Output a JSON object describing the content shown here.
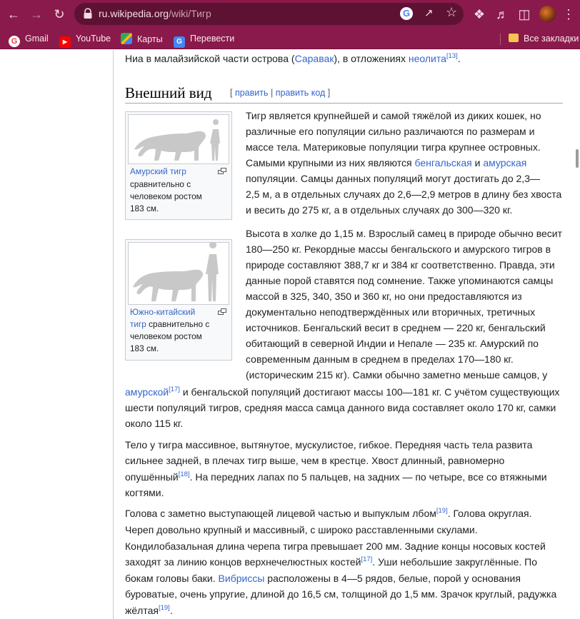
{
  "browser": {
    "url_host": "ru.wikipedia.org",
    "url_path": "/wiki/Тигр",
    "bookmarks": [
      {
        "label": "Gmail",
        "icon": "google-icon"
      },
      {
        "label": "YouTube",
        "icon": "youtube-icon"
      },
      {
        "label": "Карты",
        "icon": "maps-icon"
      },
      {
        "label": "Перевести",
        "icon": "translate-icon"
      }
    ],
    "all_bookmarks_label": "Все закладки"
  },
  "article": {
    "intro_line_a": "Ниа в малайзийской части острова (",
    "intro_link": "Саравак",
    "intro_line_b": "), в отложениях ",
    "intro_link2": "неолита",
    "intro_ref": "[13]",
    "intro_end": ".",
    "section_title": "Внешний вид",
    "edit_open": "[ ",
    "edit_label": "править",
    "edit_sep": " | ",
    "edit_code_label": "править код",
    "edit_close": " ]",
    "p1": {
      "l1": "Тигр является крупнейшей и самой тяжёлой из диких кошек, но",
      "l2": "различные его популяции сильно различаются по размерам и",
      "l3": "массе тела. Материковые популяции тигра крупнее островных.",
      "l4a": "Самыми крупными из них являются ",
      "l4_link1": "бенгальская",
      "l4b": " и ",
      "l4_link2": "амурская",
      "l5": "популяции. Самцы данных популяций могут достигать до 2,3—",
      "l6": "2,5 м, а в отдельных случаях до 2,6—2,9 метров в длину без хвоста",
      "l7": "и весить до 275 кг, а в отдельных случаях до 300—320 кг."
    },
    "p2": {
      "l1": "Высота в холке до 1,15 м. Взрослый самец в природе обычно весит",
      "l2": "180—250 кг. Рекордные массы бенгальского и амурского тигров в",
      "l3": "природе составляют 388,7 кг и 384 кг соответственно. Правда, эти",
      "l4": "данные порой ставятся под сомнение. Также упоминаются самцы",
      "l5": "массой в 325, 340, 350 и 360 кг, но они предоставляются из",
      "l6": "документально неподтверждённых или вторичных, третичных",
      "l7": "источников. Бенгальский весит в среднем — 220 кг, бенгальский",
      "l8": "обитающий в северной Индии и Непале — 235 кг. Амурский по",
      "l9": "современным данным в среднем в пределах 170—180 кг.",
      "l10": "(историческим 215 кг). Самки обычно заметно меньше самцов, у",
      "l11_link": "амурской",
      "l11_ref": "[17]",
      "l11b": " и бенгальской популяций достигают массы 100—181 кг. С учётом существующих",
      "l12": "шести популяций тигров, средняя масса самца данного вида составляет около 170 кг, самки",
      "l13": "около 115 кг."
    },
    "p3": {
      "l1": "Тело у тигра массивное, вытянутое, мускулистое, гибкое. Передняя часть тела развита",
      "l2": "сильнее задней, в плечах тигр выше, чем в крестце. Хвост длинный, равномерно",
      "l3a": "опушённый",
      "l3_ref": "[18]",
      "l3b": ". На передних лапах по 5 пальцев, на задних — по четыре, все со втяжными",
      "l4": "когтями."
    },
    "p4": {
      "l1a": "Голова с заметно выступающей лицевой частью и выпуклым лбом",
      "l1_ref": "[19]",
      "l1b": ". Голова округлая.",
      "l2": "Череп довольно крупный и массивный, с широко расставленными скулами.",
      "l3": "Кондилобазальная длина черепа тигра превышает 200 мм. Задние концы носовых костей",
      "l4a": "заходят за линию концов верхнечелюстных костей",
      "l4_ref": "[17]",
      "l4b": ". Уши небольшие закруглённые. По",
      "l5a": "бокам головы баки. ",
      "l5_link": "Вибриссы",
      "l5b": " расположены в 4—5 рядов, белые, порой у основания",
      "l6": "буроватые, очень упругие, длиной до 16,5 см, толщиной до 1,5 мм. Зрачок круглый, радужка",
      "l7a": "жёлтая",
      "l7_ref": "[19]",
      "l7b": "."
    },
    "figure1": {
      "caption_link": "Амурский тигр",
      "caption_l2": "сравнительно с",
      "caption_l3": "человеком ростом",
      "caption_l4": "183 см."
    },
    "figure2": {
      "caption_link_l1": "Южно-китайский",
      "caption_link_l2": "тигр",
      "caption_l2b": " сравнительно с",
      "caption_l3": "человеком ростом",
      "caption_l4": "183 см."
    }
  },
  "colors": {
    "chrome": "#8a1a4b",
    "link": "#3366cc",
    "text": "#202122"
  }
}
